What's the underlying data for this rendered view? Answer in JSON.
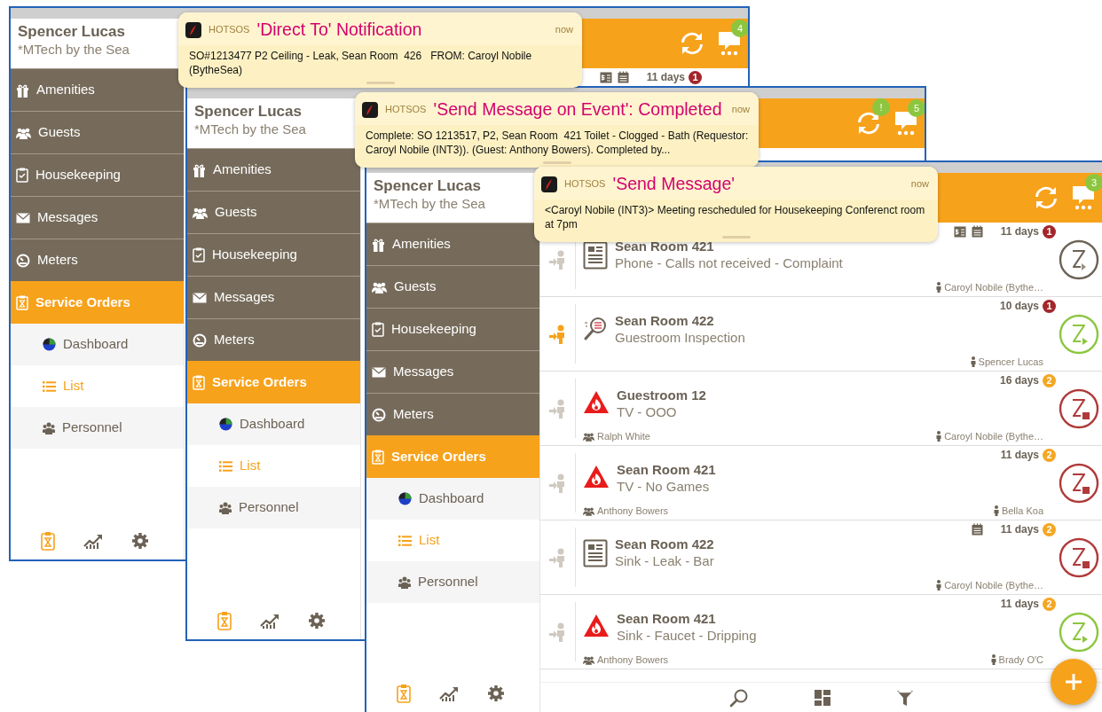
{
  "windows": [
    {
      "profile": {
        "name": "Spencer Lucas",
        "org": "*MTech by the Sea"
      },
      "nav": [
        {
          "label": "Amenities",
          "selected": false
        },
        {
          "label": "Guests",
          "selected": false
        },
        {
          "label": "Housekeeping",
          "selected": false
        },
        {
          "label": "Messages",
          "selected": false
        },
        {
          "label": "Meters",
          "selected": false
        },
        {
          "label": "Service Orders",
          "selected": true,
          "children": [
            {
              "label": "Dashboard",
              "selected": false
            },
            {
              "label": "List",
              "selected": true
            },
            {
              "label": "Personnel",
              "selected": false
            }
          ]
        }
      ],
      "footer_tabs": [
        {
          "selected": true
        },
        {
          "selected": false
        },
        {
          "selected": false
        }
      ],
      "header": {
        "messages_badge": "4"
      },
      "orders": [
        {
          "estimate": true,
          "scheduled": true,
          "days": "11 days",
          "priority": "1",
          "color": "#a3262b"
        }
      ],
      "notification": {
        "app": "HOTSOS",
        "title": "'Direct To' Notification",
        "time": "now",
        "body": "SO#1213477 P2 Ceiling - Leak, Sean Room  426   FROM: Caroyl Nobile (BytheSea)"
      }
    },
    {
      "profile": {
        "name": "Spencer Lucas",
        "org": "*MTech by the Sea"
      },
      "nav": [
        {
          "label": "Amenities",
          "selected": false
        },
        {
          "label": "Guests",
          "selected": false
        },
        {
          "label": "Housekeeping",
          "selected": false
        },
        {
          "label": "Messages",
          "selected": false
        },
        {
          "label": "Meters",
          "selected": false
        },
        {
          "label": "Service Orders",
          "selected": true,
          "children": [
            {
              "label": "Dashboard",
              "selected": false
            },
            {
              "label": "List",
              "selected": true
            },
            {
              "label": "Personnel",
              "selected": false
            }
          ]
        }
      ],
      "footer_tabs": [
        {
          "selected": true
        },
        {
          "selected": false
        },
        {
          "selected": false
        }
      ],
      "header": {
        "sync_badge": "!",
        "messages_badge": "5"
      },
      "notification": {
        "app": "HOTSOS",
        "title": "'Send Message on Event': Completed",
        "time": "now",
        "body": "Complete: SO 1213517, P2, Sean Room  421 Toilet - Clogged - Bath (Requestor: Caroyl Nobile (INT3)). (Guest: Anthony Bowers). Completed by..."
      }
    },
    {
      "profile": {
        "name": "Spencer Lucas",
        "org": "*MTech by the Sea"
      },
      "nav": [
        {
          "label": "Amenities",
          "selected": false
        },
        {
          "label": "Guests",
          "selected": false
        },
        {
          "label": "Housekeeping",
          "selected": false
        },
        {
          "label": "Messages",
          "selected": false
        },
        {
          "label": "Meters",
          "selected": false
        },
        {
          "label": "Service Orders",
          "selected": true,
          "children": [
            {
              "label": "Dashboard",
              "selected": false
            },
            {
              "label": "List",
              "selected": true
            },
            {
              "label": "Personnel",
              "selected": false
            }
          ]
        }
      ],
      "footer_tabs": [
        {
          "selected": true
        },
        {
          "selected": false
        },
        {
          "selected": false
        }
      ],
      "header": {
        "messages_badge": "3"
      },
      "orders": [
        {
          "highlighted": false,
          "kind": "document",
          "estimate": true,
          "scheduled": true,
          "days": "11 days",
          "priority": "1",
          "color": "#a3262b",
          "title": "Sean Room 421",
          "subtitle": "Phone - Calls not received - Complaint",
          "assignee": "Caroyl Nobile (Bythe…",
          "started": false,
          "stopped": false
        },
        {
          "highlighted": true,
          "kind": "inspection",
          "days": "10 days",
          "priority": "1",
          "color": "#a3262b",
          "title": "Sean Room 422",
          "subtitle": "Guestroom Inspection",
          "assignee": "Spencer Lucas",
          "started": true,
          "stopped": false
        },
        {
          "highlighted": false,
          "kind": "hazard",
          "days": "16 days",
          "priority": "2",
          "color": "#f5a623",
          "title": "Guestroom 12",
          "subtitle": "TV - OOO",
          "guest": "Ralph White",
          "assignee": "Caroyl Nobile (Bythe…",
          "stopped": true
        },
        {
          "highlighted": false,
          "kind": "hazard",
          "days": "11 days",
          "priority": "2",
          "color": "#f5a623",
          "title": "Sean Room 421",
          "subtitle": "TV - No Games",
          "guest": "Anthony Bowers",
          "assignee": "Bella Koa",
          "stopped": true
        },
        {
          "highlighted": false,
          "kind": "document",
          "scheduled": true,
          "days": "11 days",
          "priority": "2",
          "color": "#f5a623",
          "title": "Sean Room 422",
          "subtitle": "Sink - Leak - Bar",
          "assignee": "Caroyl Nobile (Bythe…",
          "stopped": true
        },
        {
          "highlighted": false,
          "kind": "hazard",
          "days": "11 days",
          "priority": "2",
          "color": "#f5a623",
          "title": "Sean Room 421",
          "subtitle": "Sink - Faucet - Dripping",
          "guest": "Anthony Bowers",
          "assignee": "Brady O'C",
          "started": true,
          "stopped": false
        }
      ],
      "toolbar": true,
      "add_button": true,
      "notification": {
        "app": "HOTSOS",
        "title": "'Send Message'",
        "time": "now",
        "body": "<Caroyl Nobile (INT3)> Meeting rescheduled for Housekeeping Conferenct room at 7pm"
      }
    }
  ]
}
